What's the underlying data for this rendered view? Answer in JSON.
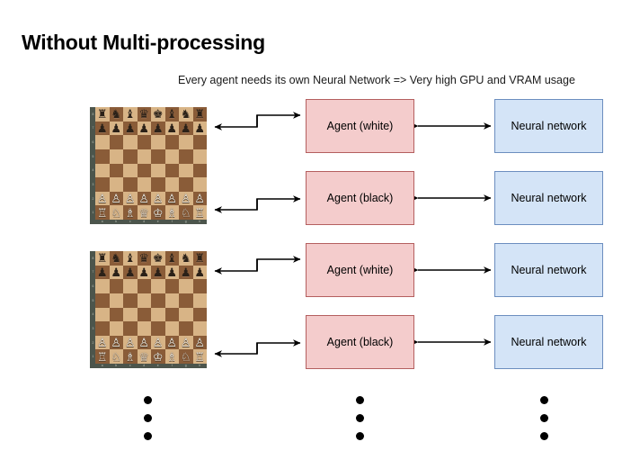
{
  "page": {
    "title": "Without Multi-processing",
    "subtitle": "Every agent needs its own Neural Network => Very high GPU and VRAM usage",
    "background": "#ffffff"
  },
  "colors": {
    "agent_fill": "#f4cccc",
    "agent_border": "#b45f5f",
    "nn_fill": "#d4e4f7",
    "nn_border": "#6c8ebf",
    "arrow": "#000000",
    "board_light": "#d8b486",
    "board_dark": "#8a5c38",
    "board_frame": "#4c554c",
    "dot": "#000000"
  },
  "board": {
    "name": "chess-board-start-position",
    "rank_labels": [
      "8",
      "7",
      "6",
      "5",
      "4",
      "3",
      "2",
      "1"
    ],
    "file_labels": [
      "a",
      "b",
      "c",
      "d",
      "e",
      "f",
      "g",
      "h"
    ],
    "rows": [
      [
        "♜",
        "♞",
        "♝",
        "♛",
        "♚",
        "♝",
        "♞",
        "♜"
      ],
      [
        "♟",
        "♟",
        "♟",
        "♟",
        "♟",
        "♟",
        "♟",
        "♟"
      ],
      [
        "",
        "",
        "",
        "",
        "",
        "",
        "",
        ""
      ],
      [
        "",
        "",
        "",
        "",
        "",
        "",
        "",
        ""
      ],
      [
        "",
        "",
        "",
        "",
        "",
        "",
        "",
        ""
      ],
      [
        "",
        "",
        "",
        "",
        "",
        "",
        "",
        ""
      ],
      [
        "♙",
        "♙",
        "♙",
        "♙",
        "♙",
        "♙",
        "♙",
        "♙"
      ],
      [
        "♖",
        "♘",
        "♗",
        "♕",
        "♔",
        "♗",
        "♘",
        "♖"
      ]
    ]
  },
  "boards": [
    {
      "label": "chess-board-1"
    },
    {
      "label": "chess-board-2"
    }
  ],
  "agents": [
    {
      "label": "Agent (white)"
    },
    {
      "label": "Agent (black)"
    },
    {
      "label": "Agent (white)"
    },
    {
      "label": "Agent (black)"
    }
  ],
  "networks": [
    {
      "label": "Neural network"
    },
    {
      "label": "Neural network"
    },
    {
      "label": "Neural network"
    },
    {
      "label": "Neural network"
    }
  ],
  "ellipsis": {
    "dot_count": 3,
    "columns": [
      "boards-more",
      "agents-more",
      "networks-more"
    ]
  }
}
